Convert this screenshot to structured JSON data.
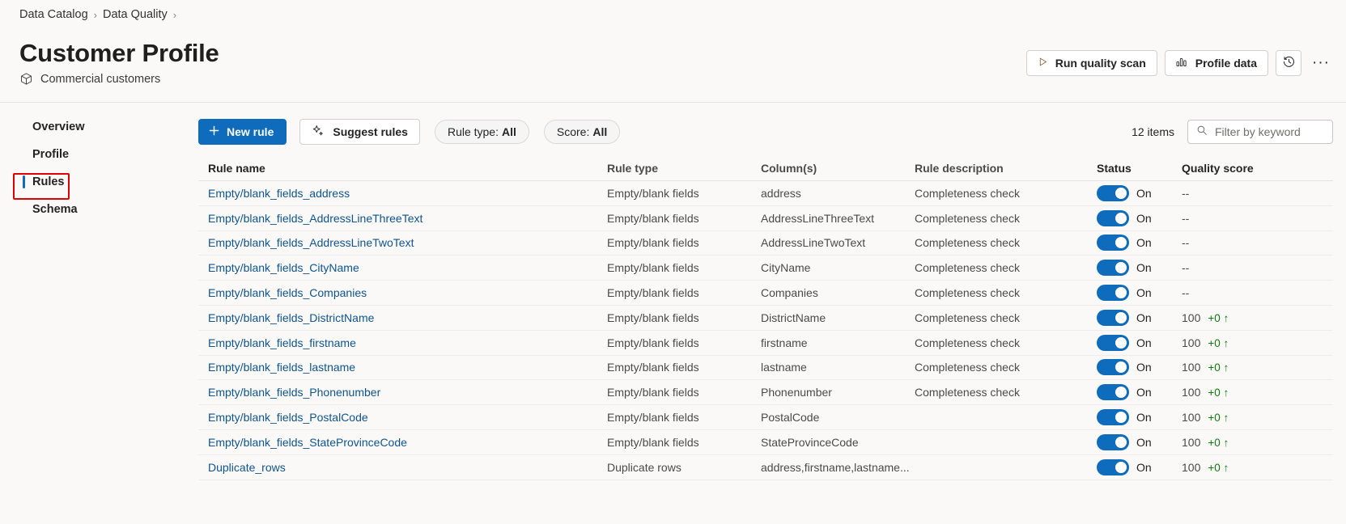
{
  "breadcrumb": {
    "items": [
      {
        "label": "Data Catalog"
      },
      {
        "label": "Data Quality"
      }
    ],
    "separator": "›"
  },
  "header": {
    "title": "Customer Profile",
    "subtitle": "Commercial customers",
    "subtitle_icon": "package-icon",
    "actions": {
      "run_quality_scan": {
        "label": "Run quality scan",
        "icon": "play-icon"
      },
      "profile_data": {
        "label": "Profile data",
        "icon": "bar-chart-icon"
      },
      "history": {
        "icon": "history-clock-icon"
      },
      "more": {
        "label": "···",
        "icon": "more-horizontal-icon"
      }
    }
  },
  "sidebar": {
    "items": [
      {
        "label": "Overview",
        "selected": false
      },
      {
        "label": "Profile",
        "selected": false
      },
      {
        "label": "Rules",
        "selected": true
      },
      {
        "label": "Schema",
        "selected": false
      }
    ],
    "annotation_color": "#e00000",
    "indicator_color": "#0f6cbd"
  },
  "toolbar": {
    "new_rule": {
      "label": "New rule",
      "icon": "plus-icon"
    },
    "suggest_rules": {
      "label": "Suggest rules",
      "icon": "sparkle-icon"
    },
    "rule_type_filter": {
      "label": "Rule type:",
      "value": "All"
    },
    "score_filter": {
      "label": "Score:",
      "value": "All"
    },
    "items_count": "12 items",
    "filter_input": {
      "value": "",
      "placeholder": "Filter by keyword",
      "icon": "search-icon"
    }
  },
  "table": {
    "columns": [
      "Rule name",
      "Rule type",
      "Column(s)",
      "Rule description",
      "Status",
      "Quality score"
    ],
    "rows": [
      {
        "name": "Empty/blank_fields_address",
        "type": "Empty/blank fields",
        "columns": "address",
        "description": "Completeness check",
        "status": "On",
        "score": "--",
        "delta": ""
      },
      {
        "name": "Empty/blank_fields_AddressLineThreeText",
        "type": "Empty/blank fields",
        "columns": "AddressLineThreeText",
        "description": "Completeness check",
        "status": "On",
        "score": "--",
        "delta": ""
      },
      {
        "name": "Empty/blank_fields_AddressLineTwoText",
        "type": "Empty/blank fields",
        "columns": "AddressLineTwoText",
        "description": "Completeness check",
        "status": "On",
        "score": "--",
        "delta": ""
      },
      {
        "name": "Empty/blank_fields_CityName",
        "type": "Empty/blank fields",
        "columns": "CityName",
        "description": "Completeness check",
        "status": "On",
        "score": "--",
        "delta": ""
      },
      {
        "name": "Empty/blank_fields_Companies",
        "type": "Empty/blank fields",
        "columns": "Companies",
        "description": "Completeness check",
        "status": "On",
        "score": "--",
        "delta": ""
      },
      {
        "name": "Empty/blank_fields_DistrictName",
        "type": "Empty/blank fields",
        "columns": "DistrictName",
        "description": "Completeness check",
        "status": "On",
        "score": "100",
        "delta": "+0 ↑"
      },
      {
        "name": "Empty/blank_fields_firstname",
        "type": "Empty/blank fields",
        "columns": "firstname",
        "description": "Completeness check",
        "status": "On",
        "score": "100",
        "delta": "+0 ↑"
      },
      {
        "name": "Empty/blank_fields_lastname",
        "type": "Empty/blank fields",
        "columns": "lastname",
        "description": "Completeness check",
        "status": "On",
        "score": "100",
        "delta": "+0 ↑"
      },
      {
        "name": "Empty/blank_fields_Phonenumber",
        "type": "Empty/blank fields",
        "columns": "Phonenumber",
        "description": "Completeness check",
        "status": "On",
        "score": "100",
        "delta": "+0 ↑"
      },
      {
        "name": "Empty/blank_fields_PostalCode",
        "type": "Empty/blank fields",
        "columns": "PostalCode",
        "description": "",
        "status": "On",
        "score": "100",
        "delta": "+0 ↑"
      },
      {
        "name": "Empty/blank_fields_StateProvinceCode",
        "type": "Empty/blank fields",
        "columns": "StateProvinceCode",
        "description": "",
        "status": "On",
        "score": "100",
        "delta": "+0 ↑"
      },
      {
        "name": "Duplicate_rows",
        "type": "Duplicate rows",
        "columns": "address,firstname,lastname...",
        "description": "",
        "status": "On",
        "score": "100",
        "delta": "+0 ↑"
      }
    ]
  },
  "colors": {
    "accent": "#0f6cbd",
    "link": "#0f548c",
    "positive": "#0e7a0d",
    "annotation": "#e00000",
    "background": "#faf9f8"
  }
}
